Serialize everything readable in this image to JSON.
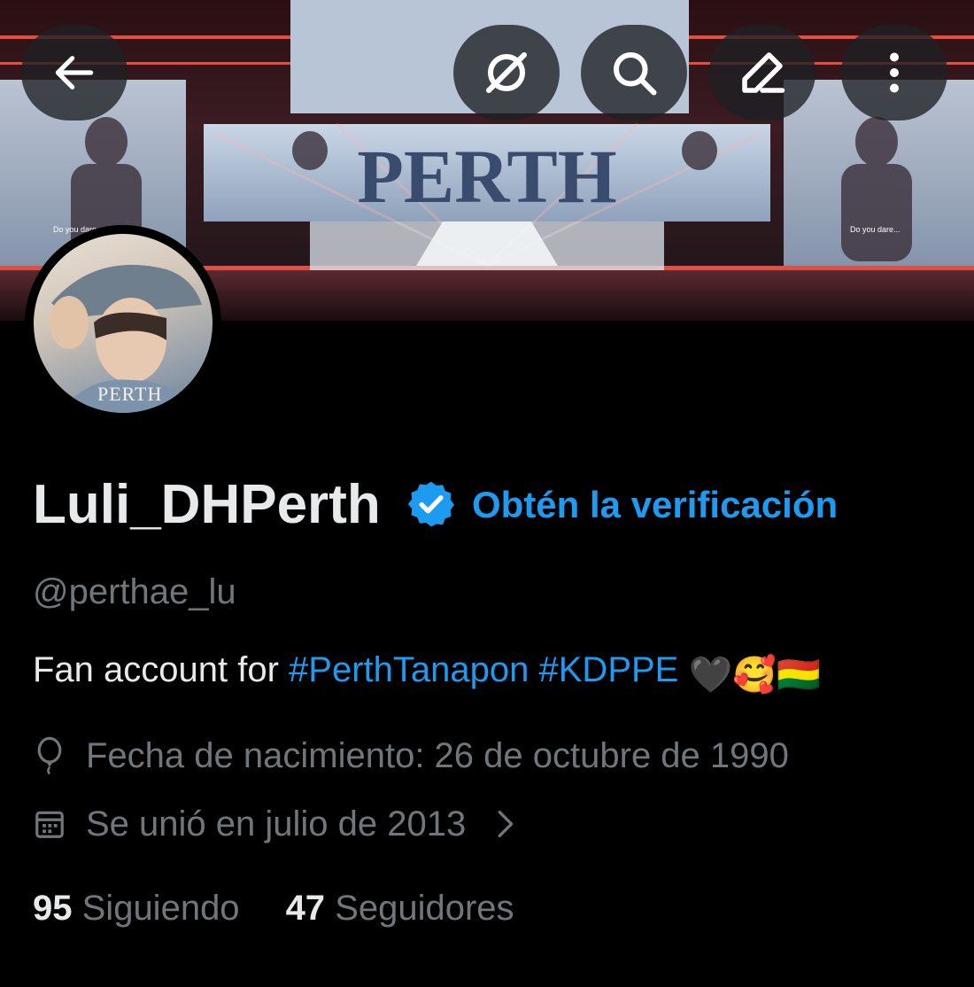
{
  "profile": {
    "name": "Luli_DHPerth",
    "get_verified": "Obtén la verificación",
    "handle": "@perthae_lu",
    "bio": {
      "prefix": "Fan account for ",
      "tag1": "#PerthTanapon",
      "tag2": "#KDPPE",
      "emojis": "🖤🥰🇧🇴"
    },
    "birth": "Fecha de nacimiento: 26 de octubre de 1990",
    "joined": "Se unió en julio de 2013",
    "following_count": "95",
    "following_label": "Siguiendo",
    "followers_count": "47",
    "followers_label": "Seguidores"
  },
  "banner": {
    "stage_text": "PERTH",
    "screen_caption": "Do you dare..."
  },
  "avatar": {
    "caption": "PERTH"
  },
  "icons": {
    "back": "arrow-left-icon",
    "grok": "grok-icon",
    "search": "search-icon",
    "edit": "edit-icon",
    "more": "more-vertical-icon",
    "verified": "verified-badge-icon",
    "birth": "balloon-icon",
    "joined": "calendar-icon",
    "chevron": "chevron-right-icon"
  },
  "colors": {
    "accent": "#1d9bf0",
    "muted": "#71767b",
    "text": "#e7e9ea",
    "background": "#000000"
  }
}
